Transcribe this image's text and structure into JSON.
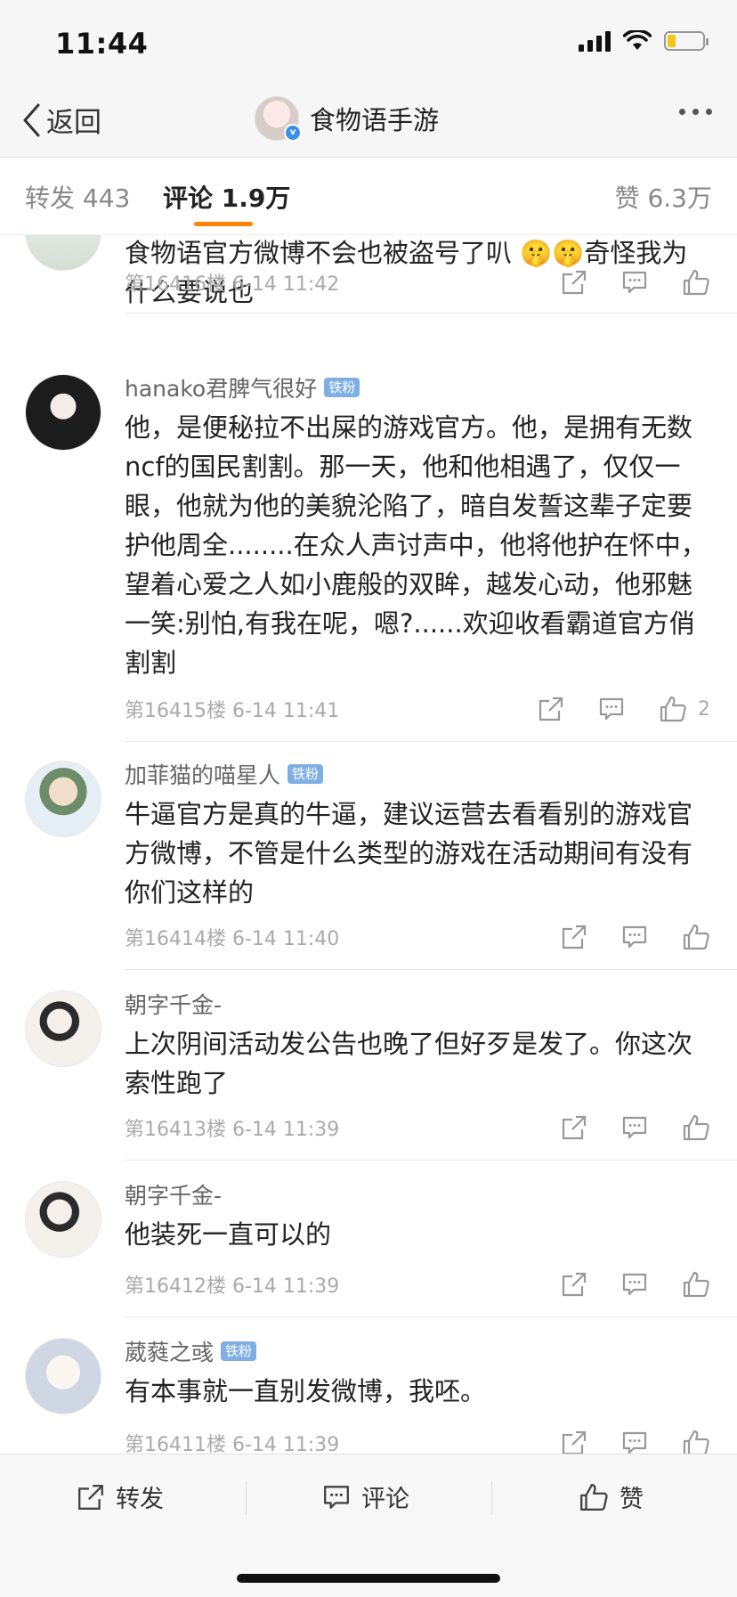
{
  "status_bar": {
    "time": "11:44"
  },
  "nav": {
    "back_label": "返回",
    "title": "食物语手游"
  },
  "tabs": {
    "repost": "转发 443",
    "comment": "评论 1.9万",
    "like": "赞 6.3万"
  },
  "comments": [
    {
      "user": "",
      "badge": "",
      "text": "食物语官方微博不会也被盗号了叭 🤫🤫奇怪我为什么要说也",
      "floor": "第16416楼 6-14 11:42",
      "likes": ""
    },
    {
      "user": "hanako君脾气很好",
      "badge": "铁粉",
      "text": "他，是便秘拉不出屎的游戏官方。他，是拥有无数ncf的国民割割。那一天，他和他相遇了，仅仅一眼，他就为他的美貌沦陷了，暗自发誓这辈子定要护他周全........在众人声讨声中，他将他护在怀中，望着心爱之人如小鹿般的双眸，越发心动，他邪魅一笑:别怕,有我在呢，嗯?......欢迎收看霸道官方俏割割",
      "floor": "第16415楼 6-14 11:41",
      "likes": "2"
    },
    {
      "user": "加菲猫的喵星人",
      "badge": "铁粉",
      "text": "牛逼官方是真的牛逼，建议运营去看看别的游戏官方微博，不管是什么类型的游戏在活动期间有没有你们这样的",
      "floor": "第16414楼 6-14 11:40",
      "likes": ""
    },
    {
      "user": "朝字千金-",
      "badge": "",
      "text": "上次阴间活动发公告也晚了但好歹是发了。你这次索性跑了",
      "floor": "第16413楼 6-14 11:39",
      "likes": ""
    },
    {
      "user": "朝字千金-",
      "badge": "",
      "text": "他装死一直可以的",
      "floor": "第16412楼 6-14 11:39",
      "likes": ""
    },
    {
      "user": "葳蕤之彧",
      "badge": "铁粉",
      "text": "有本事就一直别发微博，我呸。",
      "floor": "第16411楼 6-14 11:39",
      "likes": ""
    }
  ],
  "bottom_bar": {
    "repost": "转发",
    "comment": "评论",
    "like": "赞"
  }
}
